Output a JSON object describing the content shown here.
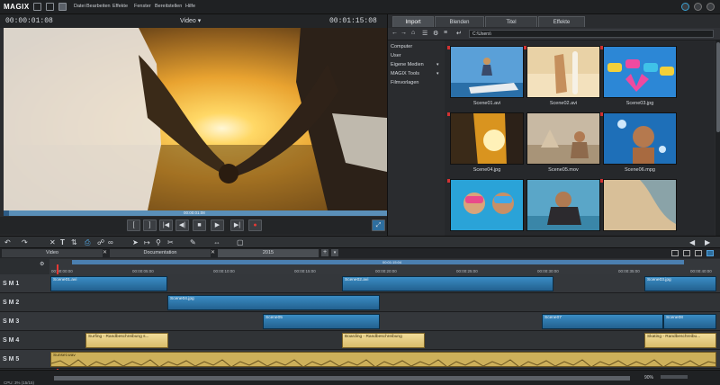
{
  "menubar": {
    "logo": "MAGIX",
    "menus": [
      "Datei",
      "Bearbeiten",
      "Effekte",
      "Fenster",
      "Bereitstellen",
      "Hilfe"
    ]
  },
  "preview": {
    "timecode_left": "00:00:01:08",
    "timecode_right": "00:01:15:08",
    "monitor_label": "Video ▾",
    "scrub_time": "00:00:01:08"
  },
  "pool": {
    "tabs": [
      "Import",
      "Blenden",
      "Titel",
      "Effekte"
    ],
    "path": "C:\\Users\\",
    "tree": [
      "Computer",
      "User",
      "Eigene Medien",
      "MAGIX Tools",
      "Filmvorlagen"
    ],
    "items": [
      {
        "label": "Scene01.avi"
      },
      {
        "label": "Scene02.avi"
      },
      {
        "label": "Scene03.jpg"
      },
      {
        "label": "Scene04.jpg"
      },
      {
        "label": "Scene05.mov"
      },
      {
        "label": "Scene06.mpg"
      },
      {
        "label": ""
      },
      {
        "label": ""
      },
      {
        "label": ""
      }
    ]
  },
  "tabs": {
    "video": "Video",
    "documentation": "Documentation",
    "year": "2015"
  },
  "ruler": {
    "marker": "00:01:15:04",
    "ticks": [
      "00:00:00:00",
      "00:00:05:00",
      "00:00:10:00",
      "00:00:15:00",
      "00:00:20:00",
      "00:00:25:00",
      "00:00:30:00",
      "00:00:35:00",
      "00:00:40:00"
    ]
  },
  "tracks": [
    {
      "label": "S M 1",
      "clips": [
        {
          "kind": "video",
          "name": "Scene01.avi"
        },
        {
          "kind": "video",
          "name": "Scene02.avi"
        },
        {
          "kind": "video",
          "name": "Scene03.jpg"
        }
      ]
    },
    {
      "label": "S M 2",
      "clips": [
        {
          "kind": "video",
          "name": "Scene04.jpg"
        }
      ]
    },
    {
      "label": "S M 3",
      "clips": [
        {
          "kind": "video",
          "name": "Scene05"
        },
        {
          "kind": "video",
          "name": "Scene07"
        },
        {
          "kind": "video",
          "name": "Scene08"
        }
      ]
    },
    {
      "label": "S M 4",
      "clips": [
        {
          "kind": "title",
          "name": "Surfing - Randbeschreibung s..."
        },
        {
          "kind": "title",
          "name": "Boarding - Randbeschreibung"
        },
        {
          "kind": "title",
          "name": "Skating - Randbeschreibu..."
        }
      ]
    },
    {
      "label": "S M 5",
      "clips": [
        {
          "kind": "audio",
          "name": "Sunset.wav"
        }
      ]
    }
  ],
  "status": {
    "cpu": "CPU: 3% (15/15)",
    "zoom": "90%"
  },
  "colors": {
    "accent": "#4b7fb0",
    "video_clip": "#2f7ab0",
    "title_clip": "#e6cf84",
    "record": "#e53935"
  }
}
